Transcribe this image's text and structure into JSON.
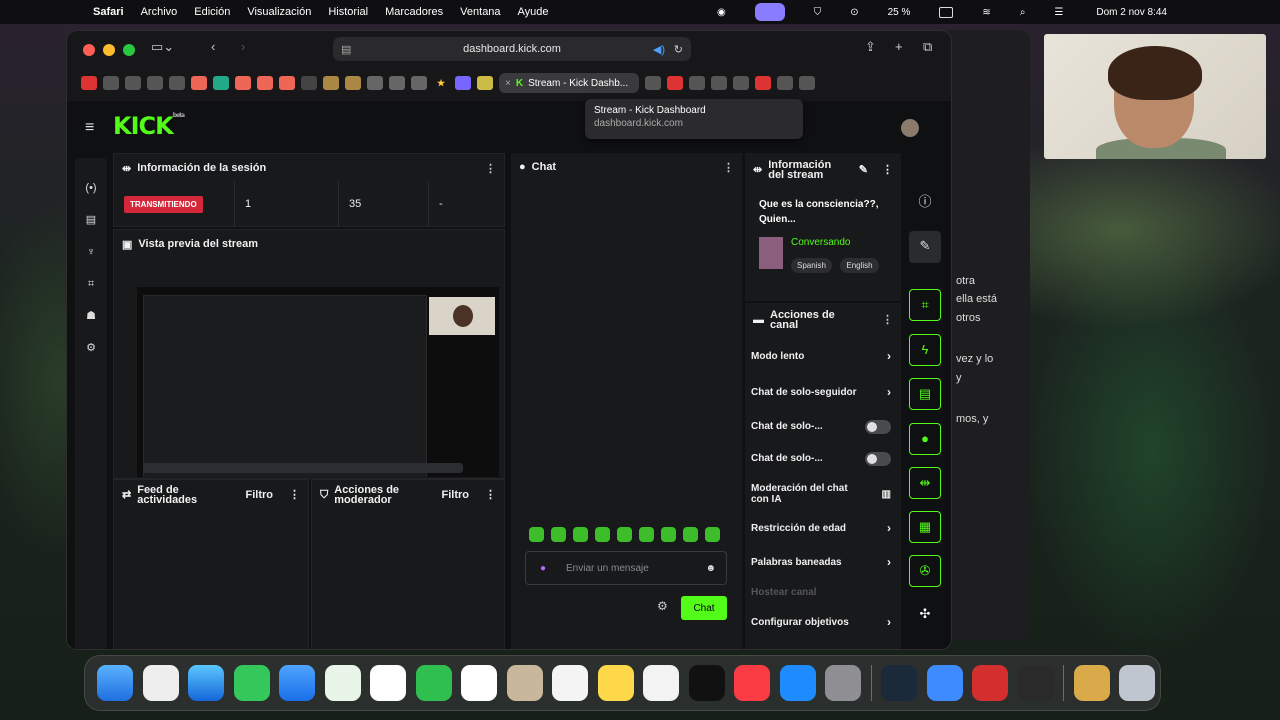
{
  "menubar": {
    "app": "Safari",
    "items": [
      "Archivo",
      "Edición",
      "Visualización",
      "Historial",
      "Marcadores",
      "Ventana",
      "Ayude"
    ],
    "battery": "25 %",
    "clock": "Dom 2 nov 8:44"
  },
  "browser": {
    "url": "dashboard.kick.com",
    "active_tab": "Stream - Kick Dashb...",
    "tooltip_title": "Stream - Kick Dashboard",
    "tooltip_url": "dashboard.kick.com"
  },
  "dashboard": {
    "session": {
      "title": "Información de la sesión",
      "status": "TRANSMITIENDO",
      "viewers": "1",
      "followers": "35",
      "extra": "-"
    },
    "preview_title": "Vista previa del stream",
    "feed_title": "Feed de actividades",
    "feed_filter": "Filtro",
    "mod_title": "Acciones de moderador",
    "mod_filter": "Filtro",
    "chat": {
      "title": "Chat",
      "placeholder": "Enviar un mensaje",
      "send": "Chat"
    },
    "stream_info": {
      "title": "Información del stream",
      "stream_title": "Que es la consciencia??, Quien...",
      "category": "Conversando",
      "tags": [
        "Spanish",
        "English"
      ]
    },
    "channel_actions": {
      "title": "Acciones de canal",
      "items": [
        {
          "label": "Modo lento",
          "control": "chevron"
        },
        {
          "label": "Chat de solo-seguidor",
          "control": "chevron"
        },
        {
          "label": "Chat de solo-...",
          "control": "toggle"
        },
        {
          "label": "Chat de solo-...",
          "control": "toggle"
        },
        {
          "label": "Moderación del chat con IA",
          "control": "icon"
        },
        {
          "label": "Restricción de edad",
          "control": "chevron"
        },
        {
          "label": "Palabras baneadas",
          "control": "chevron"
        },
        {
          "label": "Hostear canal",
          "control": "none"
        },
        {
          "label": "Configurar objetivos",
          "control": "chevron"
        }
      ]
    }
  },
  "background_text": [
    "otra",
    "ella está",
    "otros",
    "vez y lo",
    "y",
    "mos, y"
  ]
}
